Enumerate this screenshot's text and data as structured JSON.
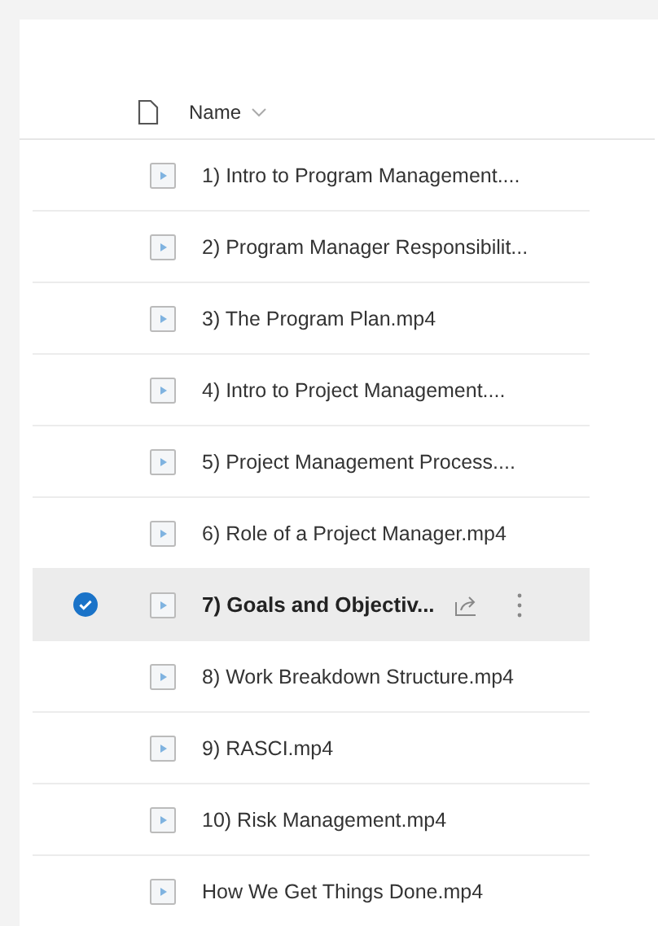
{
  "header": {
    "name_label": "Name"
  },
  "files": [
    {
      "name": "1) Intro to Program Management....",
      "selected": false
    },
    {
      "name": "2) Program Manager Responsibilit...",
      "selected": false
    },
    {
      "name": "3) The Program Plan.mp4",
      "selected": false
    },
    {
      "name": "4) Intro to Project Management....",
      "selected": false
    },
    {
      "name": "5) Project Management Process....",
      "selected": false
    },
    {
      "name": "6) Role of a Project Manager.mp4",
      "selected": false
    },
    {
      "name": "7) Goals and Objectiv...",
      "selected": true
    },
    {
      "name": "8) Work Breakdown Structure.mp4",
      "selected": false
    },
    {
      "name": "9) RASCI.mp4",
      "selected": false
    },
    {
      "name": "10) Risk Management.mp4",
      "selected": false
    },
    {
      "name": "How We Get Things Done.mp4",
      "selected": false
    }
  ]
}
